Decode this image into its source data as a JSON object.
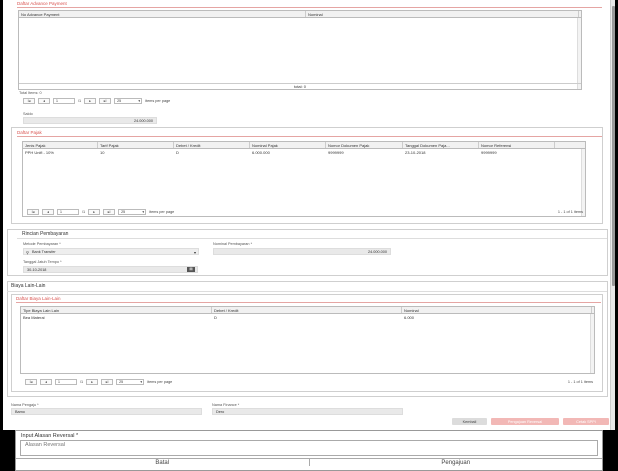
{
  "advance": {
    "section_title": "Daftar Advance Payment",
    "columns": [
      "No Advance Payment",
      "Nominal"
    ],
    "total_label": "total: 0",
    "total_items": "Total Items: 0",
    "pager": {
      "first": "I◂",
      "prev": "◂",
      "page": "1",
      "of": "/1",
      "next": "▸",
      "last": "▸I",
      "per_page_value": "25",
      "per_page_label": "items per page"
    },
    "saldo_label": "Saldo",
    "saldo_value": "24.000.000"
  },
  "pajak": {
    "section_title": "Daftar Pajak",
    "columns": [
      "Jenis Pajak",
      "Tarif Pajak",
      "Debet / Kredit",
      "Nominal Pajak",
      "Nomor Dokumen Pajak",
      "Tanggal Dokumen Paja...",
      "Nomor Referensi"
    ],
    "rows": [
      [
        "PPH Unifi - 10%",
        "10",
        "D",
        "6.000.000",
        "9999999",
        "23-10-2018",
        "9999999"
      ]
    ],
    "pager": {
      "first": "I◂",
      "prev": "◂",
      "page": "1",
      "of": "/1",
      "next": "▸",
      "last": "▸I",
      "per_page_value": "25",
      "per_page_label": "items per page",
      "range": "1 - 1 of 1 items"
    }
  },
  "rincian": {
    "title": "Rincian Pembayaran",
    "metode_label": "Metode Pembayaran *",
    "metode_value": "Bank Transfer",
    "nominal_label": "Nominal Pembayaran *",
    "nominal_value": "24.000.000",
    "tanggal_label": "Tanggal Jatuh Tempo *",
    "tanggal_value": "30-10-2018"
  },
  "biaya": {
    "title": "Biaya Lain-Lain",
    "section_title": "Daftar Biaya Lain-Lain",
    "columns": [
      "Tipe Biaya Lain Lain",
      "Debet / Kredit",
      "Nominal"
    ],
    "rows": [
      [
        "Bea Materai",
        "D",
        "6.000"
      ]
    ],
    "pager": {
      "first": "I◂",
      "prev": "◂",
      "page": "1",
      "of": "/1",
      "next": "▸",
      "last": "▸I",
      "per_page_value": "25",
      "per_page_label": "items per page",
      "range": "1 - 1 of 1 items"
    }
  },
  "footer": {
    "pengaju_label": "Nama Pengaju *",
    "pengaju_value": "Bamo",
    "finance_label": "Nama Finance *",
    "finance_value": "Dero",
    "btn_kembali": "Kembali",
    "btn_reversal": "Pengajuan Reversal",
    "btn_cetak": "Cetak SPPI"
  },
  "dialog": {
    "title": "Input Alasan Reversal *",
    "placeholder": "Alasan Reversal",
    "batal": "Batal",
    "pengajuan": "Pengajuan"
  },
  "colors": {
    "accent_red": "#d9534f",
    "btn_red": "#f2b8b6"
  }
}
